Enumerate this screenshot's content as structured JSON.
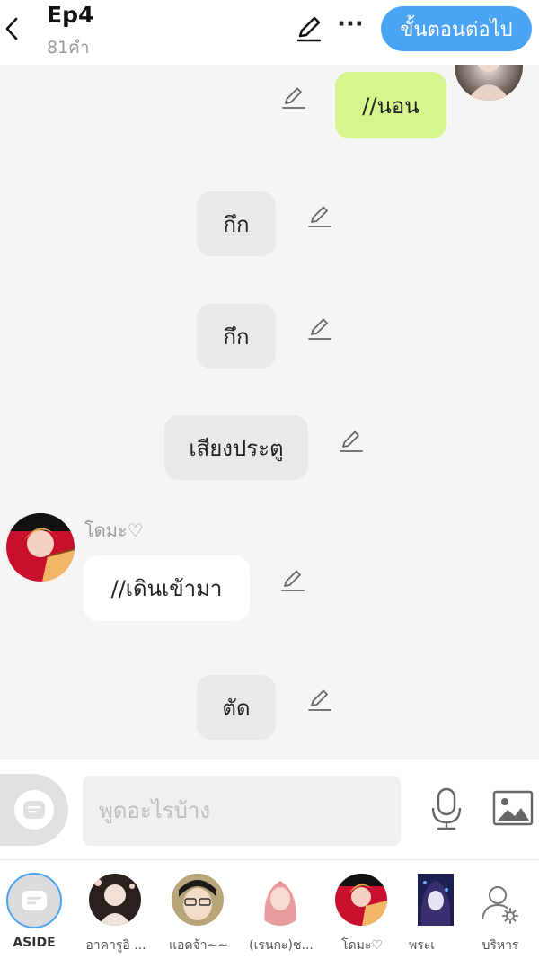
{
  "header": {
    "title": "Ep4",
    "word_count": "81คำ",
    "next_label": "ขั้นตอนต่อไป",
    "more_label": "···"
  },
  "messages": [
    {
      "type": "self",
      "text": "//นอน"
    },
    {
      "type": "narration",
      "text": "กึก"
    },
    {
      "type": "narration",
      "text": "กึก"
    },
    {
      "type": "narration",
      "text": "เสียงประตู"
    },
    {
      "type": "other",
      "speaker": "โดมะ♡",
      "text": "//เดินเข้ามา"
    },
    {
      "type": "narration",
      "text": "ตัด"
    }
  ],
  "input": {
    "placeholder": "พูดอะไรบ้าง"
  },
  "characters": [
    {
      "label": "ASIDE"
    },
    {
      "label": "อาคารูอิ ..."
    },
    {
      "label": "แอดจ้า~~"
    },
    {
      "label": "(เรนกะ)ช..."
    },
    {
      "label": "โดมะ♡"
    },
    {
      "label": "พระเ"
    },
    {
      "label": "บริหาร"
    }
  ],
  "colors": {
    "accent": "#4aa3f3",
    "self_bubble": "#d7f58d",
    "narration_bubble": "#e9e9e9",
    "background": "#f5f5f5"
  }
}
